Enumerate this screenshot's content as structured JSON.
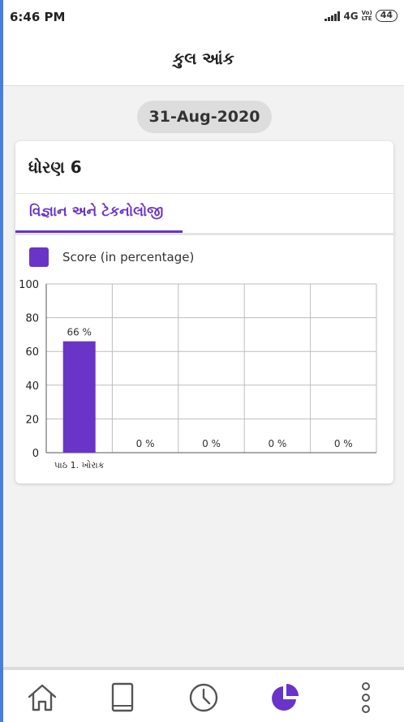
{
  "status_bar": {
    "time": "6:46 PM",
    "network": "4G",
    "lte_top": "Vo)",
    "lte_bottom": "LTE",
    "battery": "44"
  },
  "header": {
    "title": "કુલ આંક"
  },
  "date": "31-Aug-2020",
  "card": {
    "title": "ધોરણ 6",
    "tab_label": "વિજ્ઞાન અને ટેકનોલોજી",
    "legend": "Score (in percentage)"
  },
  "chart_data": {
    "type": "bar",
    "categories": [
      "પાઠ 1. ખોરાક",
      "",
      "",
      "",
      ""
    ],
    "series": [
      {
        "name": "Score (in percentage)",
        "values": [
          66,
          0,
          0,
          0,
          0
        ]
      }
    ],
    "data_labels": [
      "66 %",
      "0 %",
      "0 %",
      "0 %",
      "0 %"
    ],
    "ylim": [
      0,
      100
    ],
    "yticks": [
      0,
      20,
      40,
      60,
      80,
      100
    ],
    "grid": true,
    "legend_placement": "top-left",
    "bar_color": "#6a34c8"
  },
  "bottom_nav": {
    "items": [
      {
        "icon": "home-icon"
      },
      {
        "icon": "book-icon"
      },
      {
        "icon": "clock-icon"
      },
      {
        "icon": "pie-chart-icon",
        "active": true
      },
      {
        "icon": "more-vertical-icon"
      }
    ],
    "active_color": "#6a34c8",
    "inactive_color": "#555555"
  }
}
